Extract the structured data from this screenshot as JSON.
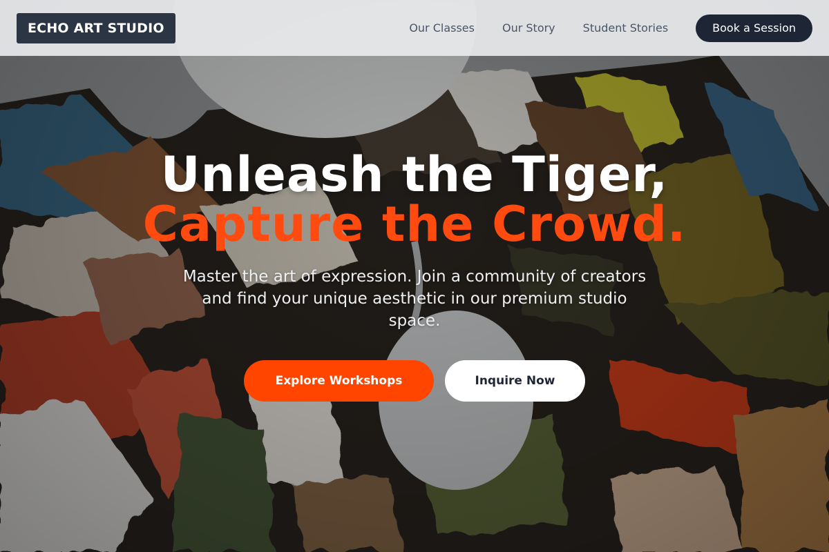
{
  "header": {
    "logo": "ECHO ART STUDIO",
    "nav": [
      {
        "label": "Our Classes"
      },
      {
        "label": "Our Story"
      },
      {
        "label": "Student Stories"
      }
    ],
    "cta_label": "Book a Session"
  },
  "hero": {
    "headline_line1": "Unleash the Tiger,",
    "headline_line2": "Capture the Crowd.",
    "subtext": "Master the art of expression. Join a community of creators and find your unique aesthetic in our premium studio space.",
    "primary_button": "Explore Workshops",
    "secondary_button": "Inquire Now"
  },
  "colors": {
    "accent": "#ff4500",
    "dark": "#1e2636",
    "logo_bg": "#2b3544",
    "header_bg": "#e8eaec"
  }
}
